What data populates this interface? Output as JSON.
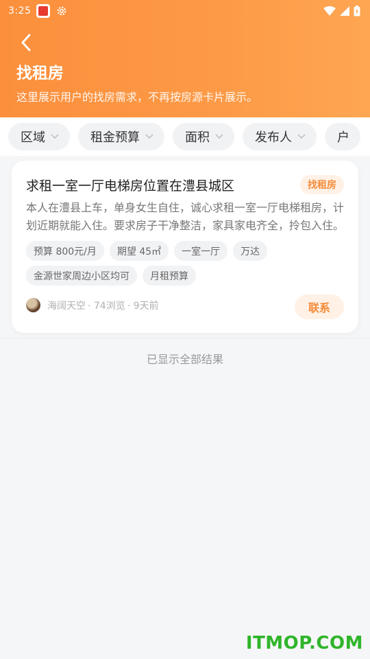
{
  "status_bar": {
    "time": "3:25"
  },
  "header": {
    "title": "找租房",
    "subtitle": "这里展示用户的找房需求，不再按房源卡片展示。"
  },
  "filters": [
    {
      "label": "区域"
    },
    {
      "label": "租金预算"
    },
    {
      "label": "面积"
    },
    {
      "label": "发布人"
    },
    {
      "label": "户"
    }
  ],
  "card": {
    "title": "求租一室一厅电梯房位置在澧县城区",
    "badge": "找租房",
    "description": "本人在澧县上车，单身女生自住，诚心求租一室一厅电梯租房，计划近期就能入住。要求房子干净整洁，家具家电齐全，拎包入住。",
    "tags": [
      "预算 800元/月",
      "期望 45㎡",
      "一室一厅",
      "万达",
      "金源世家周边小区均可",
      "月租预算"
    ],
    "author": "海阔天空",
    "views": "· 74浏览",
    "time_ago": "· 9天前",
    "contact_label": "联系"
  },
  "footer": {
    "end_text": "已显示全部结果"
  },
  "watermark": "ITMOP.COM",
  "colors": {
    "accent": "#fd9a47",
    "badge_text": "#f58a36",
    "badge_bg": "#fff1e6"
  }
}
